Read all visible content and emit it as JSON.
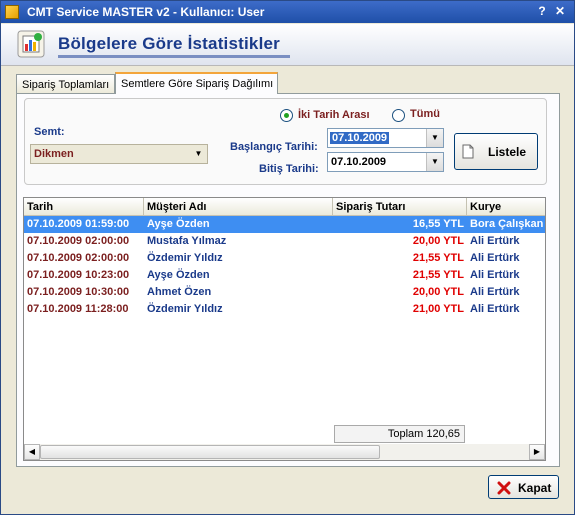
{
  "window": {
    "title": "CMT Service MASTER v2  -  Kullanıcı: User",
    "help_label": "?",
    "close_label": "✕"
  },
  "header": {
    "title": "Bölgelere Göre İstatistikler",
    "icon": "statistics-chart-icon"
  },
  "tabs": [
    {
      "label": "Sipariş Toplamları",
      "active": false
    },
    {
      "label": "Semtlere Göre Sipariş Dağılımı",
      "active": true
    }
  ],
  "filters": {
    "semt_label": "Semt:",
    "semt_value": "Dikmen",
    "range_options": [
      {
        "label": "İki Tarih Arası",
        "selected": true
      },
      {
        "label": "Tümü",
        "selected": false
      }
    ],
    "start_label": "Başlangıç Tarihi:",
    "start_value": "07.10.2009",
    "end_label": "Bitiş Tarihi:",
    "end_value": "07.10.2009",
    "list_button": "Listele",
    "list_button_icon": "document-icon"
  },
  "table": {
    "columns": [
      "Tarih",
      "Müşteri Adı",
      "Sipariş Tutarı",
      "Kurye"
    ],
    "rows": [
      {
        "date": "07.10.2009 01:59:00",
        "customer": "Ayşe Özden",
        "amount": "16,55 YTL",
        "courier": "Bora Çalışkan",
        "selected": true
      },
      {
        "date": "07.10.2009 02:00:00",
        "customer": "Mustafa Yılmaz",
        "amount": "20,00 YTL",
        "courier": "Ali Ertürk",
        "selected": false
      },
      {
        "date": "07.10.2009 02:00:00",
        "customer": "Özdemir Yıldız",
        "amount": "21,55 YTL",
        "courier": "Ali Ertürk",
        "selected": false
      },
      {
        "date": "07.10.2009 10:23:00",
        "customer": "Ayşe Özden",
        "amount": "21,55 YTL",
        "courier": "Ali Ertürk",
        "selected": false
      },
      {
        "date": "07.10.2009 10:30:00",
        "customer": "Ahmet Özen",
        "amount": "20,00 YTL",
        "courier": "Ali Ertürk",
        "selected": false
      },
      {
        "date": "07.10.2009 11:28:00",
        "customer": "Özdemir Yıldız",
        "amount": "21,00 YTL",
        "courier": "Ali Ertürk",
        "selected": false
      }
    ],
    "total": "Toplam 120,65"
  },
  "footer": {
    "close_button": "Kapat",
    "close_icon": "red-x-icon"
  },
  "colors": {
    "title_blue": "#1a3a8a",
    "date_maroon": "#7b1f1f",
    "amount_red": "#e00000",
    "selection": "#3e8ef2"
  }
}
